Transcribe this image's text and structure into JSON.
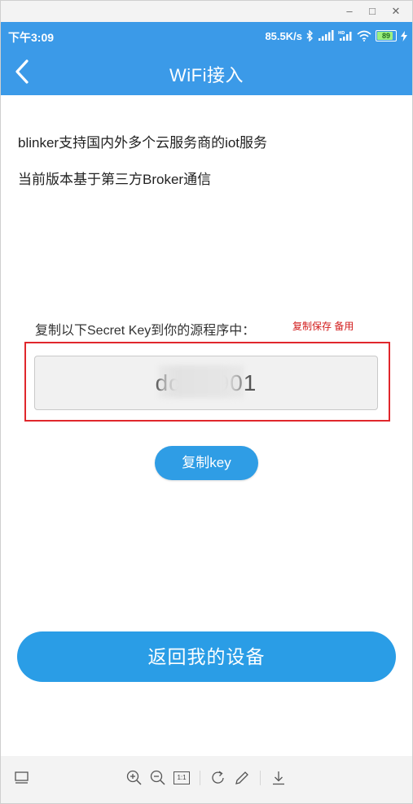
{
  "window": {
    "minimize_glyph": "–",
    "maximize_glyph": "□",
    "close_glyph": "✕"
  },
  "status_bar": {
    "time": "下午3:09",
    "network_speed": "85.5K/s",
    "icons": [
      "bluetooth-icon",
      "signal-icon",
      "hd-signal-icon",
      "wifi-icon"
    ],
    "battery": "89",
    "charging_icon": "bolt-icon"
  },
  "header": {
    "back_icon": "chevron-left-icon",
    "title": "WiFi接入"
  },
  "content": {
    "intro_line_1": "blinker支持国内外多个云服务商的iot服务",
    "intro_line_2": "当前版本基于第三方Broker通信",
    "key_label": "复制以下Secret Key到你的源程序中：",
    "annotation_note": "复制保存 备用",
    "secret_key_display": "dd3        2901",
    "copy_key_button": "复制key",
    "return_button": "返回我的设备"
  },
  "toolbar": {
    "icons": [
      "layout-icon",
      "zoom-in-icon",
      "zoom-out-icon",
      "actual-size-icon",
      "rotate-icon",
      "pencil-icon",
      "download-icon"
    ],
    "actual_size_label": "1:1"
  },
  "colors": {
    "primary": "#3b9ae8",
    "button": "#2a9de6",
    "annotation": "#e0272c"
  }
}
